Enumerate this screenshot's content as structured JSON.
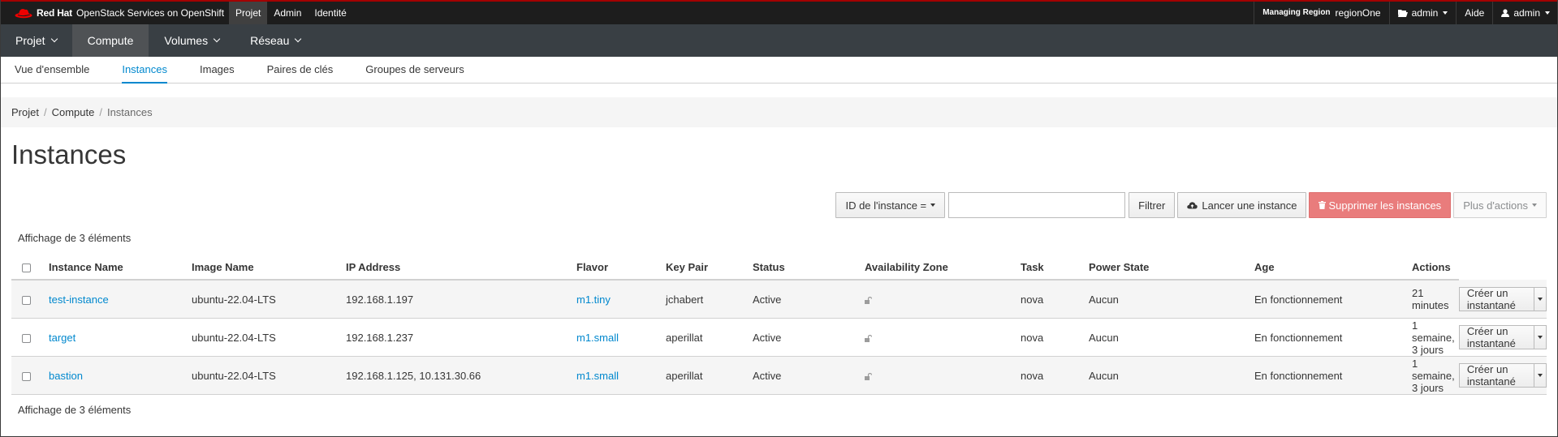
{
  "brand": {
    "company": "Red Hat",
    "product": "OpenStack Services on OpenShift"
  },
  "topnav": [
    {
      "label": "Projet",
      "active": true
    },
    {
      "label": "Admin",
      "active": false
    },
    {
      "label": "Identité",
      "active": false
    }
  ],
  "utility": {
    "region_label": "Managing Region",
    "region_value": "regionOne",
    "project": "admin",
    "help": "Aide",
    "user": "admin"
  },
  "secnav": [
    {
      "label": "Projet",
      "dropdown": true,
      "active": false
    },
    {
      "label": "Compute",
      "dropdown": false,
      "active": true
    },
    {
      "label": "Volumes",
      "dropdown": true,
      "active": false
    },
    {
      "label": "Réseau",
      "dropdown": true,
      "active": false
    }
  ],
  "tabs": [
    {
      "label": "Vue d'ensemble",
      "active": false
    },
    {
      "label": "Instances",
      "active": true
    },
    {
      "label": "Images",
      "active": false
    },
    {
      "label": "Paires de clés",
      "active": false
    },
    {
      "label": "Groupes de serveurs",
      "active": false
    }
  ],
  "breadcrumb": {
    "items": [
      "Projet",
      "Compute"
    ],
    "current": "Instances"
  },
  "page_title": "Instances",
  "toolbar": {
    "filter_select": "ID de l'instance =",
    "filter_value": "",
    "filter_button": "Filtrer",
    "launch_button": "Lancer une instance",
    "delete_button": "Supprimer les instances",
    "more_button": "Plus d'actions"
  },
  "count_text": "Affichage de 3 éléments",
  "table": {
    "columns": [
      "Instance Name",
      "Image Name",
      "IP Address",
      "Flavor",
      "Key Pair",
      "Status",
      "Availability Zone",
      "Task",
      "Power State",
      "Age",
      "Actions"
    ],
    "rows": [
      {
        "name": "test-instance",
        "image": "ubuntu-22.04-LTS",
        "ip": "192.168.1.197",
        "flavor": "m1.tiny",
        "keypair": "jchabert",
        "status": "Active",
        "zone": "nova",
        "task": "Aucun",
        "power": "En fonctionnement",
        "age": "21 minutes",
        "action": "Créer un instantané"
      },
      {
        "name": "target",
        "image": "ubuntu-22.04-LTS",
        "ip": "192.168.1.237",
        "flavor": "m1.small",
        "keypair": "aperillat",
        "status": "Active",
        "zone": "nova",
        "task": "Aucun",
        "power": "En fonctionnement",
        "age": "1 semaine, 3 jours",
        "action": "Créer un instantané"
      },
      {
        "name": "bastion",
        "image": "ubuntu-22.04-LTS",
        "ip": "192.168.1.125, 10.131.30.66",
        "flavor": "m1.small",
        "keypair": "aperillat",
        "status": "Active",
        "zone": "nova",
        "task": "Aucun",
        "power": "En fonctionnement",
        "age": "1 semaine, 3 jours",
        "action": "Créer un instantané"
      }
    ]
  },
  "colors": {
    "accent": "#0088ce",
    "masthead": "#1d1d1d",
    "secnav": "#393f44",
    "danger": "#e97c7c",
    "brand_red": "#ee0000"
  },
  "icons": {
    "brand": "redhat-hat-icon",
    "project": "folder-open-icon",
    "user": "user-icon",
    "launch": "cloud-upload-icon",
    "delete": "trash-icon",
    "lock": "unlock-icon"
  }
}
